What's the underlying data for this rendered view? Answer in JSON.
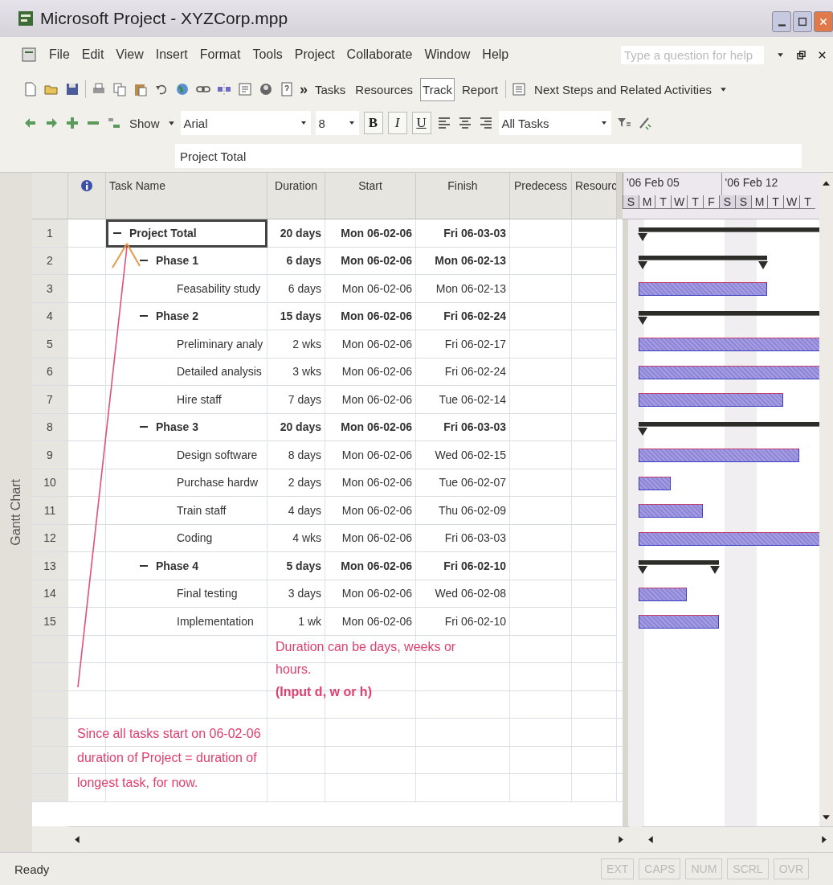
{
  "window": {
    "title": "Microsoft Project - XYZCorp.mpp"
  },
  "menu": [
    {
      "label": "File"
    },
    {
      "label": "Edit"
    },
    {
      "label": "View"
    },
    {
      "label": "Insert"
    },
    {
      "label": "Format"
    },
    {
      "label": "Tools"
    },
    {
      "label": "Project"
    },
    {
      "label": "Collaborate"
    },
    {
      "label": "Window"
    },
    {
      "label": "Help"
    }
  ],
  "help_search": {
    "placeholder": "Type a question for help"
  },
  "toolbar": {
    "more": "»",
    "guide_buttons": [
      {
        "label": "Tasks",
        "selected": false
      },
      {
        "label": "Resources",
        "selected": false
      },
      {
        "label": "Track",
        "selected": true
      },
      {
        "label": "Report",
        "selected": false
      }
    ],
    "activities": "Next Steps and Related Activities"
  },
  "format_bar": {
    "show": "Show",
    "font": "Arial",
    "size": "8",
    "styles": [
      {
        "label": "B",
        "kind": "bold"
      },
      {
        "label": "I",
        "kind": "italic"
      },
      {
        "label": "U",
        "kind": "underline"
      }
    ],
    "filter": "All Tasks"
  },
  "entry_bar": {
    "value": "Project Total"
  },
  "view_bar": {
    "label": "Gantt Chart"
  },
  "table": {
    "columns": [
      "Task Name",
      "Duration",
      "Start",
      "Finish",
      "Predecess",
      "Resourc"
    ],
    "tasks": [
      {
        "id": "1",
        "name": "Project Total",
        "kind": "summary",
        "expanded": true,
        "selected": true,
        "duration": "20 days",
        "start": "Mon 06-02-06",
        "finish": "Fri 06-03-03",
        "children": [
          {
            "id": "2",
            "name": "Phase 1",
            "kind": "summary",
            "expanded": true,
            "selected": false,
            "duration": "6 days",
            "start": "Mon 06-02-06",
            "finish": "Mon 06-02-13",
            "children": [
              {
                "id": "3",
                "name": "Feasability study",
                "kind": "task",
                "selected": false,
                "duration": "6 days",
                "start": "Mon 06-02-06",
                "finish": "Mon 06-02-13"
              }
            ]
          },
          {
            "id": "4",
            "name": "Phase 2",
            "kind": "summary",
            "expanded": true,
            "selected": false,
            "duration": "15 days",
            "start": "Mon 06-02-06",
            "finish": "Fri 06-02-24",
            "children": [
              {
                "id": "5",
                "name": "Preliminary analy",
                "kind": "task",
                "selected": false,
                "duration": "2 wks",
                "start": "Mon 06-02-06",
                "finish": "Fri 06-02-17"
              },
              {
                "id": "6",
                "name": "Detailed analysis",
                "kind": "task",
                "selected": false,
                "duration": "3 wks",
                "start": "Mon 06-02-06",
                "finish": "Fri 06-02-24"
              },
              {
                "id": "7",
                "name": "Hire staff",
                "kind": "task",
                "selected": false,
                "duration": "7 days",
                "start": "Mon 06-02-06",
                "finish": "Tue 06-02-14"
              }
            ]
          },
          {
            "id": "8",
            "name": "Phase 3",
            "kind": "summary",
            "expanded": true,
            "selected": false,
            "duration": "20 days",
            "start": "Mon 06-02-06",
            "finish": "Fri 06-03-03",
            "children": [
              {
                "id": "9",
                "name": "Design software",
                "kind": "task",
                "selected": false,
                "duration": "8 days",
                "start": "Mon 06-02-06",
                "finish": "Wed 06-02-15"
              },
              {
                "id": "10",
                "name": "Purchase hardw",
                "kind": "task",
                "selected": false,
                "duration": "2 days",
                "start": "Mon 06-02-06",
                "finish": "Tue 06-02-07"
              },
              {
                "id": "11",
                "name": "Train staff",
                "kind": "task",
                "selected": false,
                "duration": "4 days",
                "start": "Mon 06-02-06",
                "finish": "Thu 06-02-09"
              },
              {
                "id": "12",
                "name": "Coding",
                "kind": "task",
                "selected": false,
                "duration": "4 wks",
                "start": "Mon 06-02-06",
                "finish": "Fri 06-03-03"
              }
            ]
          },
          {
            "id": "13",
            "name": "Phase 4",
            "kind": "summary",
            "expanded": true,
            "selected": false,
            "duration": "5 days",
            "start": "Mon 06-02-06",
            "finish": "Fri 06-02-10",
            "children": [
              {
                "id": "14",
                "name": "Final testing",
                "kind": "task",
                "selected": false,
                "duration": "3 days",
                "start": "Mon 06-02-06",
                "finish": "Wed 06-02-08"
              },
              {
                "id": "15",
                "name": "Implementation",
                "kind": "task",
                "selected": false,
                "duration": "1 wk",
                "start": "Mon 06-02-06",
                "finish": "Fri 06-02-10"
              }
            ]
          }
        ]
      }
    ]
  },
  "timescale": {
    "weeks": [
      "'06 Feb 05",
      "'06 Feb 12"
    ],
    "days": [
      {
        "label": "S",
        "nonworking": true
      },
      {
        "label": "M",
        "nonworking": false
      },
      {
        "label": "T",
        "nonworking": false
      },
      {
        "label": "W",
        "nonworking": false
      },
      {
        "label": "T",
        "nonworking": false
      },
      {
        "label": "F",
        "nonworking": false
      },
      {
        "label": "S",
        "nonworking": true
      },
      {
        "label": "S",
        "nonworking": true
      },
      {
        "label": "M",
        "nonworking": false
      },
      {
        "label": "T",
        "nonworking": false
      },
      {
        "label": "W",
        "nonworking": false
      },
      {
        "label": "T",
        "nonworking": false
      }
    ]
  },
  "annotations": [
    {
      "text": "Duration can be days, weeks or hours.",
      "emphasis": "(Input d, w or h)"
    },
    {
      "text": "Since all tasks start on 06-02-06 duration of Project = duration of longest task, for now."
    }
  ],
  "status_bar": {
    "text": "Ready",
    "indicators": [
      {
        "label": "EXT",
        "on": false
      },
      {
        "label": "CAPS",
        "on": false
      },
      {
        "label": "NUM",
        "on": false
      },
      {
        "label": "SCRL",
        "on": false
      },
      {
        "label": "OVR",
        "on": false
      }
    ]
  }
}
